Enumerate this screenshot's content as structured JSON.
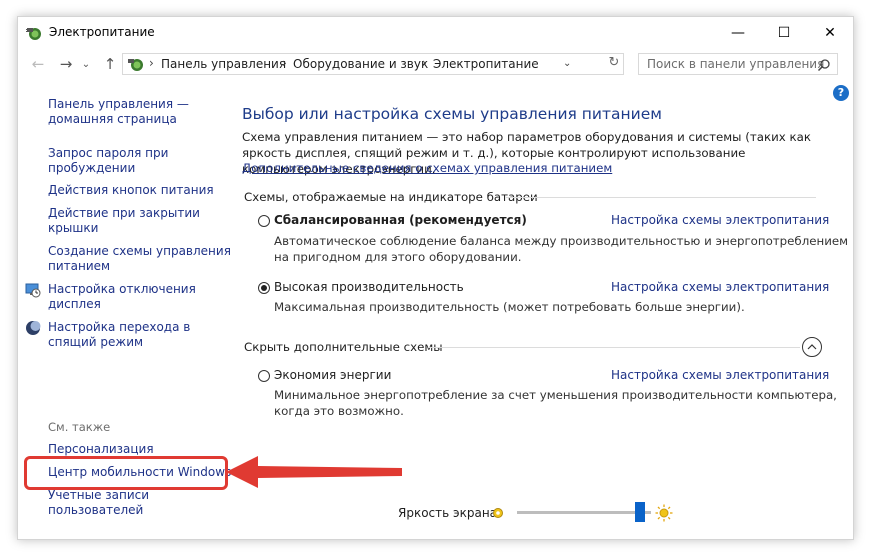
{
  "window": {
    "title": "Электропитание",
    "minimize": "—",
    "maximize": "☐",
    "close": "✕"
  },
  "address": {
    "crumbs": [
      "Панель управления",
      "Оборудование и звук",
      "Электропитание"
    ],
    "separator": "›",
    "search_placeholder": "Поиск в панели управления"
  },
  "sidebar": {
    "items": [
      {
        "line1": "Панель управления —",
        "line2": "домашняя страница"
      },
      {
        "line1": "Запрос пароля при",
        "line2": "пробуждении"
      },
      {
        "line1": "Действия кнопок питания",
        "line2": ""
      },
      {
        "line1": "Действие при закрытии",
        "line2": "крышки"
      },
      {
        "line1": "Создание схемы управления",
        "line2": "питанием"
      },
      {
        "line1": "Настройка отключения",
        "line2": "дисплея",
        "icon": "display-clock-icon"
      },
      {
        "line1": "Настройка перехода в",
        "line2": "спящий режим",
        "icon": "moon-icon"
      }
    ],
    "see_also": "См. также",
    "see_also_items": [
      {
        "line1": "Персонализация",
        "line2": ""
      },
      {
        "line1": "Центр мобильности Windows",
        "line2": ""
      },
      {
        "line1": "Учетные записи",
        "line2": "пользователей"
      }
    ]
  },
  "main": {
    "title": "Выбор или настройка схемы управления питанием",
    "description": "Схема управления питанием — это набор параметров оборудования и системы (таких как яркость дисплея, спящий режим и т. д.), которые контролируют использование компьютером электроэнергии.",
    "more_link": "Дополнительные сведения о схемах управления питанием",
    "battery_group": "Схемы, отображаемые на индикаторе батареи",
    "hidden_group": "Скрыть дополнительные схемы",
    "plans": [
      {
        "name": "Сбалансированная (рекомендуется)",
        "selected": false,
        "desc1": "Автоматическое соблюдение баланса между производительностью и энергопотреблением",
        "desc2": "на пригодном для этого оборудовании.",
        "link": "Настройка схемы электропитания"
      },
      {
        "name": "Высокая производительность",
        "selected": true,
        "desc1": "Максимальная производительность (может потребовать больше энергии).",
        "desc2": "",
        "link": "Настройка схемы электропитания"
      },
      {
        "name": "Экономия энергии",
        "selected": false,
        "desc1": "Минимальное энергопотребление за счет уменьшения производительности компьютера,",
        "desc2": "когда это возможно.",
        "link": "Настройка схемы электропитания"
      }
    ],
    "brightness_label": "Яркость экрана:",
    "brightness_level": 0.92
  },
  "colors": {
    "link": "#1e3287",
    "title": "#1e3c8a",
    "highlight": "#e03a32",
    "slider_thumb": "#0a63c9"
  }
}
